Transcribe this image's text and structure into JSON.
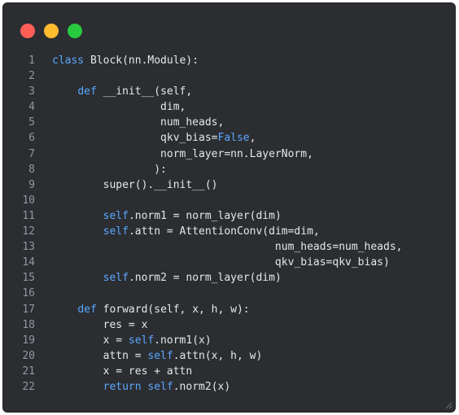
{
  "colors": {
    "window_bg": "#2b2d31",
    "traffic_red": "#ff5f57",
    "traffic_yellow": "#febc2e",
    "traffic_green": "#28c840",
    "keyword": "#5aa8ff",
    "text": "#e6e7ea",
    "line_number": "#9097a0"
  },
  "window_controls": [
    "close",
    "minimize",
    "maximize"
  ],
  "code_lines": [
    {
      "n": "1",
      "segments": [
        {
          "t": "class",
          "kw": true
        },
        {
          "t": " Block(nn.Module):"
        }
      ]
    },
    {
      "n": "2",
      "segments": []
    },
    {
      "n": "3",
      "segments": [
        {
          "t": "    "
        },
        {
          "t": "def",
          "kw": true
        },
        {
          "t": " __init__(self,"
        }
      ]
    },
    {
      "n": "4",
      "segments": [
        {
          "t": "                 dim,"
        }
      ]
    },
    {
      "n": "5",
      "segments": [
        {
          "t": "                 num_heads,"
        }
      ]
    },
    {
      "n": "6",
      "segments": [
        {
          "t": "                 qkv_bias="
        },
        {
          "t": "False",
          "kw": true
        },
        {
          "t": ","
        }
      ]
    },
    {
      "n": "7",
      "segments": [
        {
          "t": "                 norm_layer=nn.LayerNorm,"
        }
      ]
    },
    {
      "n": "8",
      "segments": [
        {
          "t": "                ):"
        }
      ]
    },
    {
      "n": "9",
      "segments": [
        {
          "t": "        super().__init__()"
        }
      ]
    },
    {
      "n": "10",
      "segments": []
    },
    {
      "n": "11",
      "segments": [
        {
          "t": "        "
        },
        {
          "t": "self",
          "kw": true
        },
        {
          "t": ".norm1 = norm_layer(dim)"
        }
      ]
    },
    {
      "n": "12",
      "segments": [
        {
          "t": "        "
        },
        {
          "t": "self",
          "kw": true
        },
        {
          "t": ".attn = AttentionConv(dim=dim,"
        }
      ]
    },
    {
      "n": "13",
      "segments": [
        {
          "t": "                                   num_heads=num_heads,"
        }
      ]
    },
    {
      "n": "14",
      "segments": [
        {
          "t": "                                   qkv_bias=qkv_bias)"
        }
      ]
    },
    {
      "n": "15",
      "segments": [
        {
          "t": "        "
        },
        {
          "t": "self",
          "kw": true
        },
        {
          "t": ".norm2 = norm_layer(dim)"
        }
      ]
    },
    {
      "n": "16",
      "segments": []
    },
    {
      "n": "17",
      "segments": [
        {
          "t": "    "
        },
        {
          "t": "def",
          "kw": true
        },
        {
          "t": " forward(self, x, h, w):"
        }
      ]
    },
    {
      "n": "18",
      "segments": [
        {
          "t": "        res = x"
        }
      ]
    },
    {
      "n": "19",
      "segments": [
        {
          "t": "        x = "
        },
        {
          "t": "self",
          "kw": true
        },
        {
          "t": ".norm1(x)"
        }
      ]
    },
    {
      "n": "20",
      "segments": [
        {
          "t": "        attn = "
        },
        {
          "t": "self",
          "kw": true
        },
        {
          "t": ".attn(x, h, w)"
        }
      ]
    },
    {
      "n": "21",
      "segments": [
        {
          "t": "        x = res + attn"
        }
      ]
    },
    {
      "n": "22",
      "segments": [
        {
          "t": "        "
        },
        {
          "t": "return",
          "kw": true
        },
        {
          "t": " "
        },
        {
          "t": "self",
          "kw": true
        },
        {
          "t": ".norm2(x)"
        }
      ]
    }
  ]
}
